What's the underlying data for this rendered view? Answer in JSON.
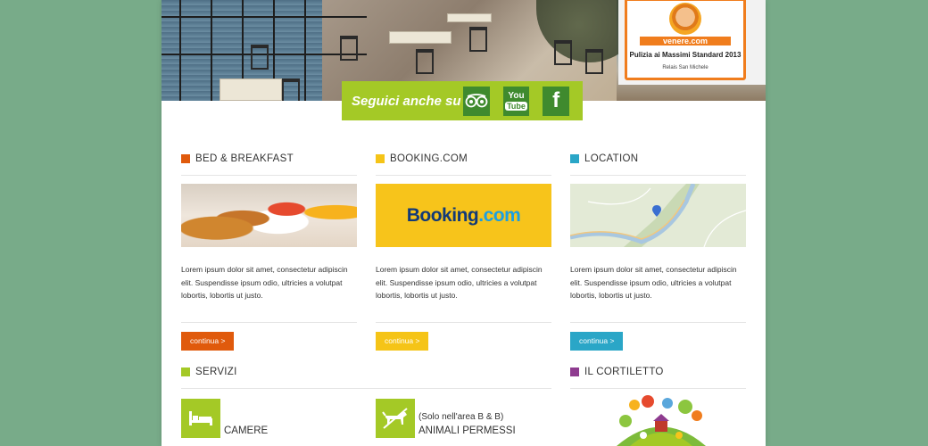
{
  "award": {
    "brand": "venere.com",
    "title": "Pulizia ai Massimi Standard 2013",
    "subtitle": "Relais San Michele"
  },
  "social": {
    "label": "Seguici anche su",
    "buttons": [
      {
        "name": "tripadvisor",
        "icon": "tripadvisor-icon"
      },
      {
        "name": "youtube",
        "label_top": "You",
        "label_bottom": "Tube",
        "icon": "youtube-icon"
      },
      {
        "name": "facebook",
        "label": "f",
        "icon": "facebook-icon"
      }
    ]
  },
  "columns": [
    {
      "title": "BED & BREAKFAST",
      "color": "#e05a0c",
      "text": "Lorem ipsum dolor sit amet, consectetur adipiscin elit. Suspendisse ipsum odio, ultricies a volutpat lobortis, lobortis ut justo.",
      "button": "continua >"
    },
    {
      "title": "BOOKING.COM",
      "color": "#f5c417",
      "logo_main": "Booking",
      "logo_dot": ".com",
      "text": "Lorem ipsum dolor sit amet, consectetur adipiscin elit. Suspendisse ipsum odio, ultricies a volutpat lobortis, lobortis ut justo.",
      "button": "continua >"
    },
    {
      "title": "LOCATION",
      "color": "#2aa6c7",
      "text": "Lorem ipsum dolor sit amet, consectetur adipiscin elit. Suspendisse ipsum odio, ultricies a volutpat lobortis, lobortis ut justo.",
      "button": "continua >"
    }
  ],
  "services": {
    "title": "SERVIZI",
    "color": "#a4c926",
    "items": [
      {
        "label": "CAMERE",
        "note": "",
        "icon": "bed-icon"
      },
      {
        "label": "ANIMALI PERMESSI",
        "note": "(Solo nell'area B & B)",
        "icon": "dog-icon"
      }
    ]
  },
  "cortiletto": {
    "title": "IL CORTILETTO",
    "color": "#8e3b8f"
  }
}
